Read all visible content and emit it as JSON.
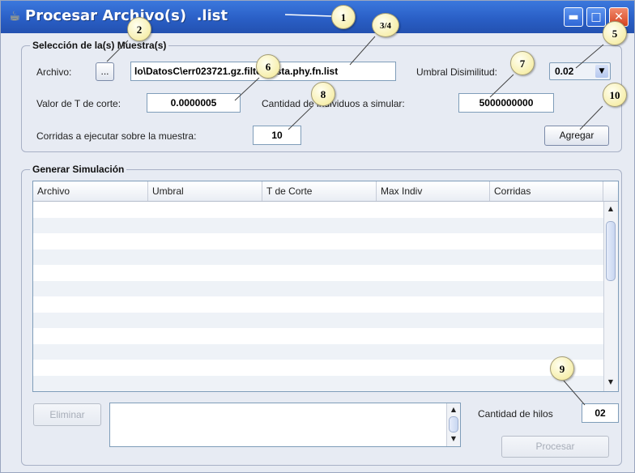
{
  "window": {
    "title": "Procesar Archivo(s)  .list",
    "controls": [
      "minimize-icon",
      "maximize-icon",
      "close-icon"
    ]
  },
  "sample_group": {
    "title": "Selección de la(s) Muestra(s)",
    "archivo_label": "Archivo:",
    "browse_button": "...",
    "archivo_value": "lo\\DatosC\\err023721.gz.filter.fasta.phy.fn.list",
    "umbral_label": "Umbral Disimilitud:",
    "umbral_value": "0.02",
    "t_corte_label": "Valor de T de corte:",
    "t_corte_value": "0.0000005",
    "individuos_label": "Cantidad de individuos a simular:",
    "individuos_value": "5000000000",
    "corridas_label": "Corridas a ejecutar sobre la muestra:",
    "corridas_value": "10",
    "agregar_button": "Agregar"
  },
  "simulation_group": {
    "title": "Generar Simulación",
    "columns": [
      "Archivo",
      "Umbral",
      "T de Corte",
      "Max Indiv",
      "Corridas"
    ],
    "rows": [],
    "eliminar_button": "Eliminar",
    "hilos_label": "Cantidad de hilos",
    "hilos_value": "02",
    "procesar_button": "Procesar"
  },
  "callouts": [
    "1",
    "2",
    "3/4",
    "5",
    "6",
    "7",
    "8",
    "9",
    "10"
  ],
  "colors": {
    "title_bar": "#2a5fc6",
    "window_bg": "#e7ebf3",
    "callout_fill": "#f7efae"
  }
}
